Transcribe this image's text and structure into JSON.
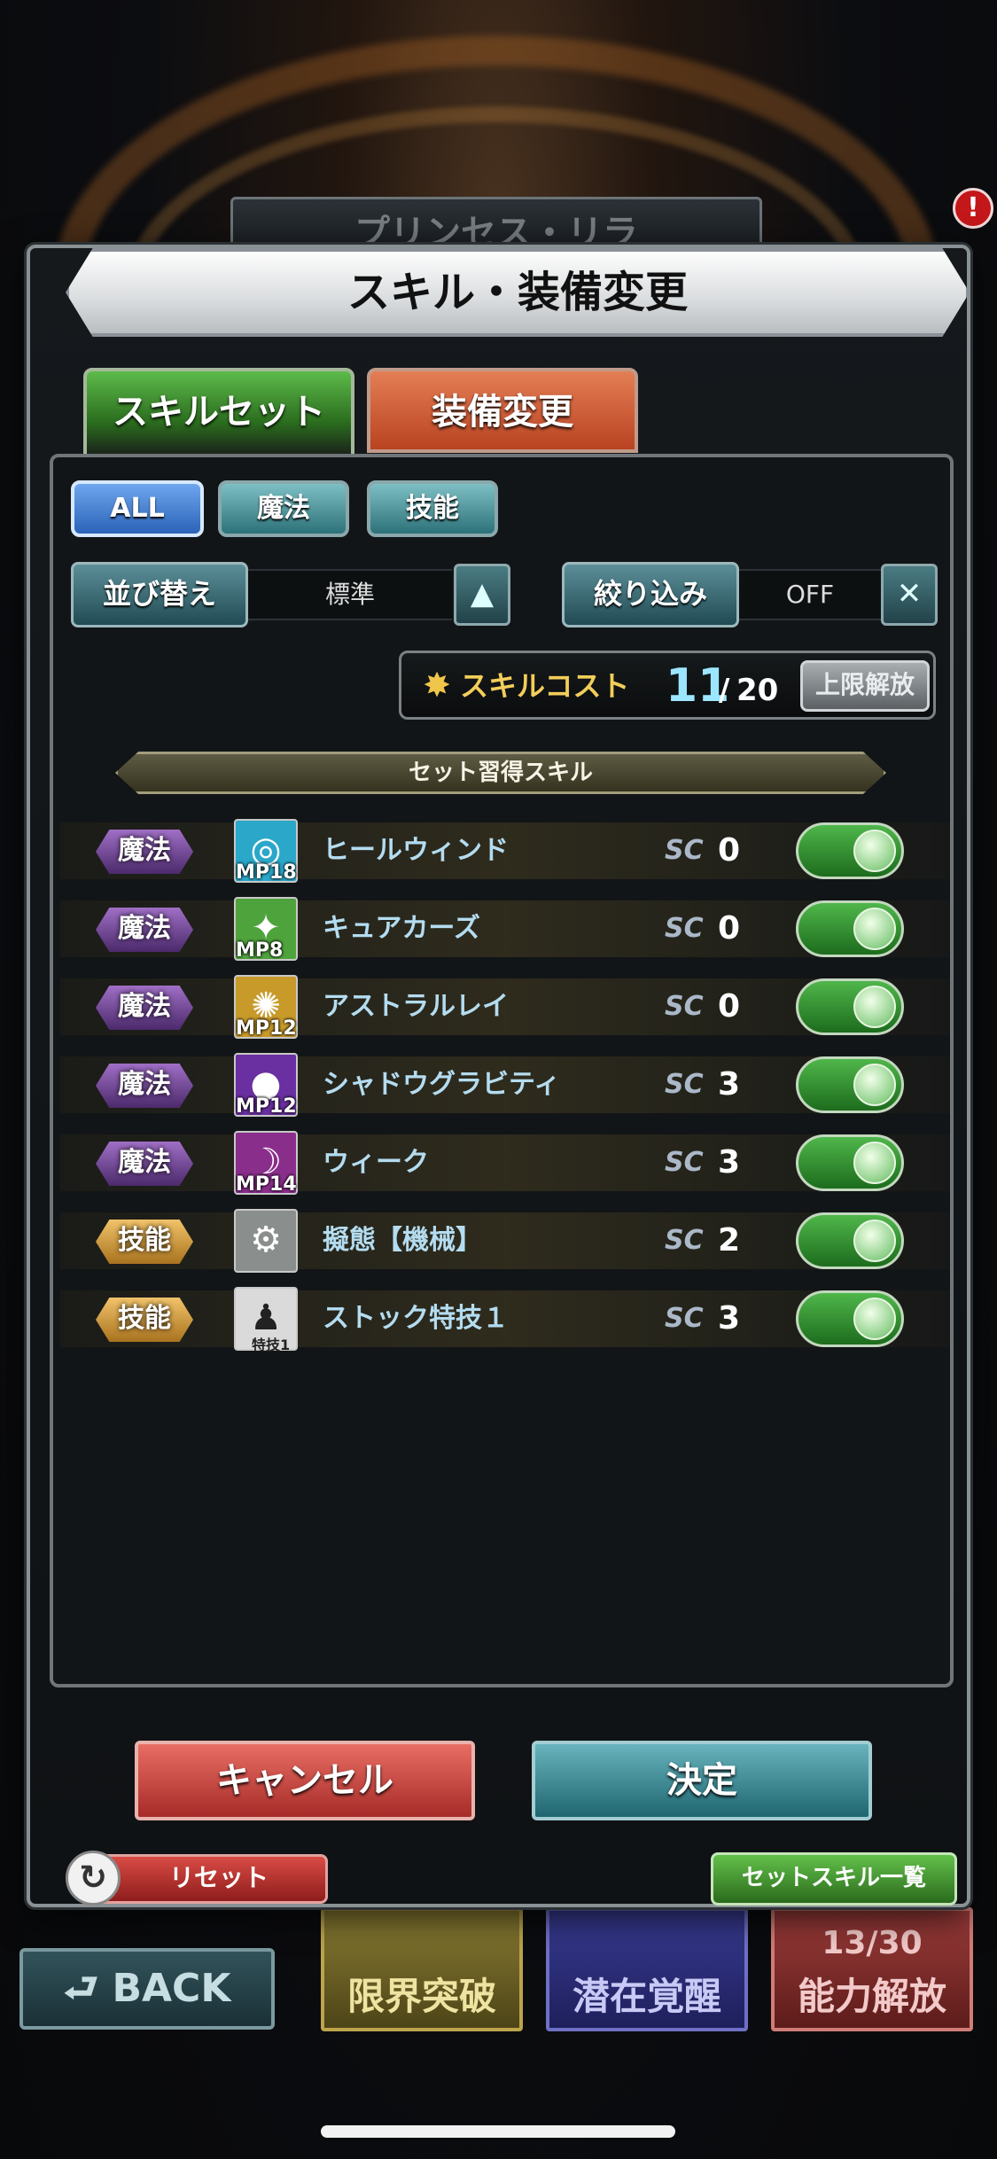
{
  "background": {
    "character_name": "プリンセス・リラ",
    "notification_badge": "!",
    "back_label": "BACK",
    "tiles": [
      {
        "label": "限界突破",
        "count": ""
      },
      {
        "label": "潜在覚醒",
        "count": ""
      },
      {
        "label": "能力解放",
        "count": "13/30"
      }
    ]
  },
  "dialog": {
    "title": "スキル・装備変更",
    "tabs": [
      {
        "label": "スキルセット",
        "active": true
      },
      {
        "label": "装備変更",
        "active": false
      }
    ],
    "filters": [
      {
        "label": "ALL",
        "selected": true
      },
      {
        "label": "魔法",
        "selected": false
      },
      {
        "label": "技能",
        "selected": false
      }
    ],
    "sort": {
      "label": "並び替え",
      "value": "標準",
      "toggle_icon": "triangle-up-icon"
    },
    "narrow": {
      "label": "絞り込み",
      "value": "OFF",
      "clear_icon": "close-icon"
    },
    "skill_cost": {
      "label": "スキルコスト",
      "icon_text": "SC",
      "current": "11",
      "slash": "/",
      "max": "20",
      "unlock_label": "上限解放"
    },
    "section_header": "セット習得スキル",
    "skills": [
      {
        "type": "魔法",
        "icon": "wind-icon",
        "icon_color": "#2aa7c9",
        "mp": "MP18",
        "name": "ヒールウィンド",
        "sc_label": "SC",
        "sc": "0",
        "enabled": true
      },
      {
        "type": "魔法",
        "icon": "cure-icon",
        "icon_color": "#4fa33c",
        "mp": "MP8",
        "name": "キュアカーズ",
        "sc_label": "SC",
        "sc": "0",
        "enabled": true
      },
      {
        "type": "魔法",
        "icon": "light-ray-icon",
        "icon_color": "#c79a2a",
        "mp": "MP12",
        "name": "アストラルレイ",
        "sc_label": "SC",
        "sc": "0",
        "enabled": true
      },
      {
        "type": "魔法",
        "icon": "gravity-icon",
        "icon_color": "#6a2fa0",
        "mp": "MP12",
        "name": "シャドウグラビティ",
        "sc_label": "SC",
        "sc": "3",
        "enabled": true
      },
      {
        "type": "魔法",
        "icon": "weak-icon",
        "icon_color": "#8a2e8c",
        "mp": "MP14",
        "name": "ウィーク",
        "sc_label": "SC",
        "sc": "3",
        "enabled": true
      },
      {
        "type": "技能",
        "icon": "machine-icon",
        "icon_color": "#8a8f8d",
        "mp": "",
        "name": "擬態【機械】",
        "sc_label": "SC",
        "sc": "2",
        "enabled": true
      },
      {
        "type": "技能",
        "icon": "stock-skill-icon",
        "icon_color": "#2c2c2c",
        "mp": "特技1",
        "name": "ストック特技１",
        "sc_label": "SC",
        "sc": "3",
        "enabled": true
      }
    ],
    "reset_label": "リセット",
    "skill_list_label": "セットスキル一覧",
    "cancel_label": "キャンセル",
    "confirm_label": "決定"
  }
}
